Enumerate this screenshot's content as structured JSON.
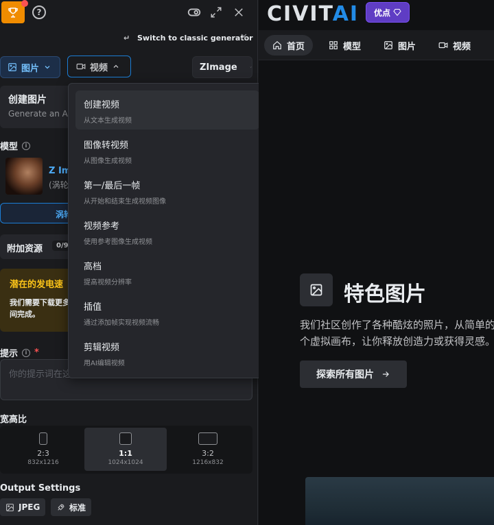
{
  "left": {
    "switch_classic": "Switch to classic generator",
    "type_images_label": "图片",
    "type_video_label": "视频",
    "model_select_label": "ZImage",
    "create_title": "创建图片",
    "create_subtitle": "Generate an AI",
    "model_label": "模型",
    "model_name": "Z Im",
    "model_sub": "(涡轮)",
    "swap_label": "涡轮",
    "extras_label": "附加资源",
    "extras_count": "0/9",
    "warn_title": "潜在的发电速",
    "warn_line1": "我们需要下载更多",
    "warn_line2": "间完成。",
    "prompt_label": "提示",
    "prompt_required": "*",
    "prompt_placeholder": "你的提示词在这",
    "aspect_label": "宽高比",
    "ratios": [
      {
        "name": "2:3",
        "dims": "832x1216"
      },
      {
        "name": "1:1",
        "dims": "1024x1024"
      },
      {
        "name": "3:2",
        "dims": "1216x832"
      }
    ],
    "output_label": "Output Settings",
    "format_label": "JPEG",
    "quality_label": "标准"
  },
  "dropdown": {
    "items": [
      {
        "title": "创建视频",
        "sub": "从文本生成视频"
      },
      {
        "title": "图像转视频",
        "sub": "从图像生成视频"
      },
      {
        "title": "第一/最后一帧",
        "sub": "从开始和结束生成视频图像"
      },
      {
        "title": "视频参考",
        "sub": "使用参考图像生成视频"
      },
      {
        "title": "高档",
        "sub": "提高视频分辨率"
      },
      {
        "title": "插值",
        "sub": "通过添加帧实现视频流畅"
      },
      {
        "title": "剪辑视频",
        "sub": "用AI编辑视频"
      }
    ]
  },
  "right": {
    "logo_main": "CIVIT",
    "logo_ai": "AI",
    "promo_label": "优点",
    "nav": {
      "home": "首页",
      "models": "模型",
      "images": "图片",
      "videos": "视频"
    },
    "featured_title": "特色图片",
    "featured_desc_1": "我们社区创作了各种酷炫的照片，从简单的",
    "featured_desc_2": "个虚拟画布，让你释放创造力或获得灵感。",
    "explore_label": "探索所有图片"
  }
}
